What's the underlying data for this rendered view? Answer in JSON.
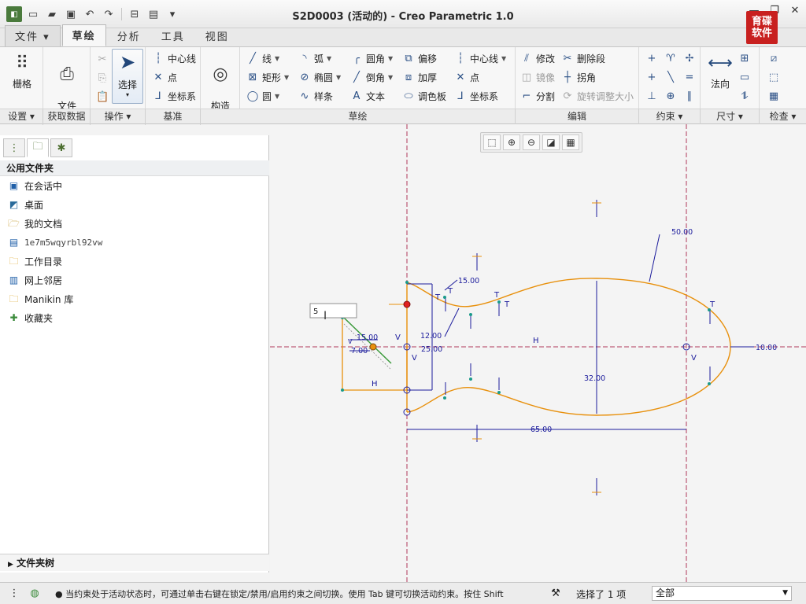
{
  "window": {
    "title": "S2D0003 (活动的) - Creo Parametric 1.0",
    "logo_text": "育碟软件"
  },
  "tabs": [
    "文件 ▾",
    "草绘",
    "分析",
    "工具",
    "视图"
  ],
  "ribbon": {
    "setup": {
      "grid": "栅格"
    },
    "getdata": {
      "file_system": "文件\n系统"
    },
    "ops": {
      "select": "选择"
    },
    "datum": {
      "centerline": "中心线",
      "point": "点",
      "csys": "坐标系"
    },
    "construction": "构造\n模式",
    "sketch": {
      "line": "线",
      "rect": "矩形",
      "circle": "圆",
      "arc": "弧",
      "ellipse": "椭圆",
      "spline": "样条",
      "fillet": "圆角",
      "chamfer": "倒角",
      "text": "文本",
      "offset": "偏移",
      "thicken": "加厚",
      "palette": "调色板",
      "centerline": "中心线",
      "point": "点",
      "csys": "坐标系"
    },
    "edit": {
      "modify": "修改",
      "delete_segment": "删除段",
      "mirror": "镜像",
      "corner": "拐角",
      "divide": "分割",
      "rotate_resize": "旋转调整大小"
    },
    "dimension": {
      "normal": "法向"
    }
  },
  "group_labels": [
    "设置 ▾",
    "获取数据",
    "操作 ▾",
    "基准",
    "草绘",
    "编辑",
    "约束 ▾",
    "尺寸 ▾",
    "检查 ▾"
  ],
  "panel": {
    "header": "公用文件夹",
    "items": [
      "在会话中",
      "桌面",
      "我的文档",
      "1e7m5wqyrbl92vw",
      "工作目录",
      "网上邻居",
      "Manikin 库",
      "收藏夹"
    ],
    "footer": "文件夹树"
  },
  "sketch": {
    "dims": {
      "d50": "50.00",
      "d15_top": "15.00",
      "d12": "12.00",
      "d25": "25.00",
      "d32": "32.00",
      "d65": "65.00",
      "d10": "10.00",
      "d15_left": "15.00",
      "d7": "7.00"
    },
    "constraint_H": "H",
    "constraint_V": "V",
    "constraint_T": "T",
    "edit_box_value": "5"
  },
  "status": {
    "message": "● 当约束处于活动状态时，可通过单击右键在锁定/禁用/启用约束之间切换。使用 Tab 键可切换活动约束。按住 Shift",
    "selected": "选择了 1 项",
    "filter": "全部"
  },
  "colors": {
    "sketch_line": "#e8900c",
    "dimension": "#1c1c9c",
    "centerline": "#b0385a",
    "constraint_point": "#1a9a8a",
    "red_point": "#e02020"
  }
}
